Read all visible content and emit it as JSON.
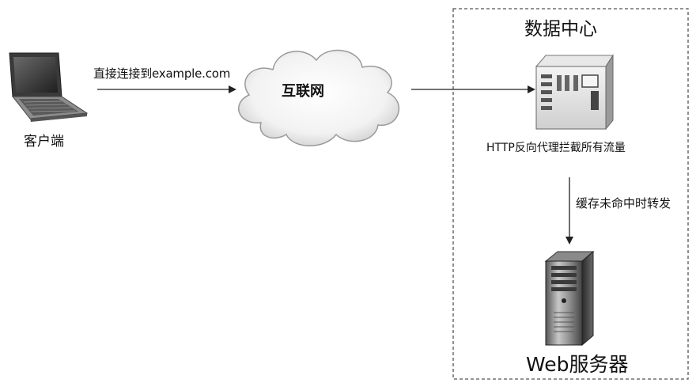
{
  "diagram": {
    "client_label": "客户端",
    "direct_connection_label": "直接连接到example.com",
    "internet_label": "互联网",
    "datacenter_label": "数据中心",
    "proxy_label": "HTTP反向代理拦截所有流量",
    "cache_miss_label": "缓存未命中时转发",
    "web_server_label": "Web服务器"
  }
}
